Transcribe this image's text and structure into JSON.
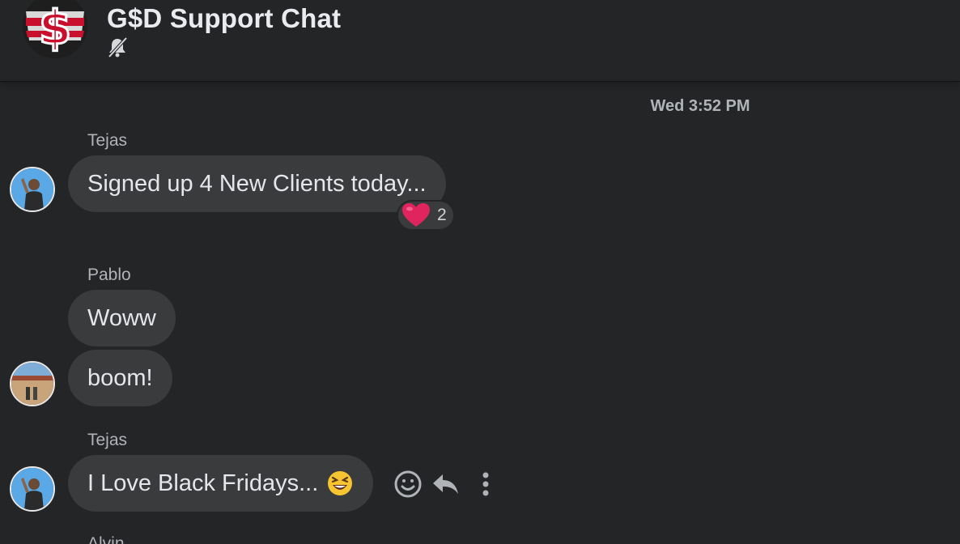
{
  "header": {
    "title": "G$D Support Chat",
    "notifications_icon": "bell-muted-icon"
  },
  "timestamp": "Wed 3:52 PM",
  "messages": [
    {
      "sender": "Tejas",
      "text": "Signed up 4 New Clients today...",
      "reaction": {
        "emoji": "heart",
        "count": "2"
      }
    },
    {
      "sender": "Pablo",
      "texts": [
        "Woww",
        "boom!"
      ]
    },
    {
      "sender": "Tejas",
      "text": "I Love Black Fridays...",
      "emoji": "laughing-face"
    },
    {
      "sender": "Alvin"
    }
  ],
  "message_actions": [
    "smiley-icon",
    "reply-icon",
    "more-options-icon"
  ],
  "colors": {
    "background": "#242526",
    "bubble": "#3a3b3c",
    "text": "#e4e6eb",
    "meta_text": "#b0b3b8",
    "heart": "#e0245e",
    "emoji_yellow": "#f7c531"
  }
}
